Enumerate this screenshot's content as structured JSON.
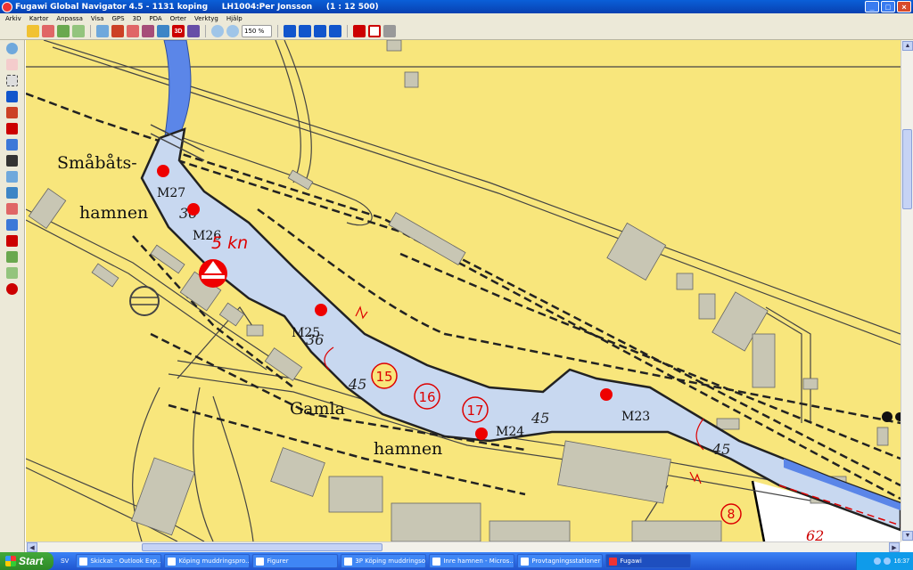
{
  "window": {
    "title": "Fugawi Global Navigator 4.5 - 1131 koping     LH1004:Per Jonsson     (1 : 12 500)",
    "minimize_label": "_",
    "maximize_label": "□",
    "close_label": "×"
  },
  "menu": [
    "Arkiv",
    "Kartor",
    "Anpassa",
    "Visa",
    "GPS",
    "3D",
    "PDA",
    "Orter",
    "Verktyg",
    "Hjälp"
  ],
  "toolbar": {
    "zoom_value": "150 %",
    "icons": [
      "open-icon",
      "pan-icon",
      "route-icon",
      "track-icon",
      "map-icon",
      "export-icon",
      "print-icon",
      "copy-icon",
      "window-icon",
      "3d-label",
      "settings-icon",
      "zoom-in-icon",
      "zoom-out-icon",
      "arrow-left-icon",
      "arrow-right-icon",
      "arrow-up-icon",
      "arrow-down-icon",
      "nav-icon",
      "stop-icon",
      "anchor-icon"
    ],
    "label_3d": "3D"
  },
  "map": {
    "place_labels": [
      "Småbåts-",
      "hamnen",
      "Gamla",
      "hamnen"
    ],
    "markers": [
      {
        "label": "M27"
      },
      {
        "label": "M26"
      },
      {
        "label": "M25"
      },
      {
        "label": "M24"
      },
      {
        "label": "M23"
      }
    ],
    "speed_label": "5 kn",
    "buoys": [
      "15",
      "16",
      "17",
      "8"
    ],
    "depths": [
      "36",
      "36",
      "45",
      "45",
      "45",
      "62"
    ],
    "colors": {
      "land": "#f8e67c",
      "water": "#c8d8f0",
      "river": "#5b86e8",
      "marker": "#ee0000"
    }
  },
  "taskbar": {
    "start_label": "Start",
    "language": "SV",
    "tasks": [
      "Skickat - Outlook Exp...",
      "Köping muddringspro...",
      "Figurer",
      "3P Köping muddringso...",
      "Inre hamnen - Micros...",
      "Provtagningsstationer",
      "Fugawi"
    ],
    "clock": "16:37"
  }
}
